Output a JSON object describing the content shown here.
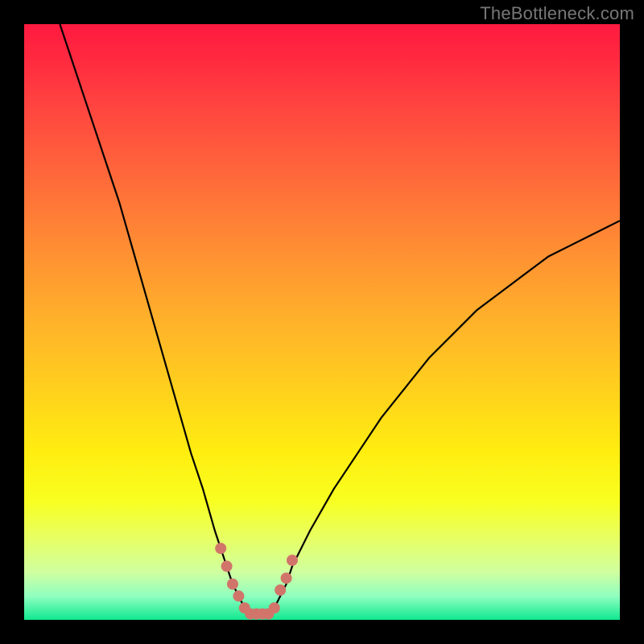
{
  "watermark": "TheBottleneck.com",
  "chart_data": {
    "type": "line",
    "title": "",
    "xlabel": "",
    "ylabel": "",
    "xlim": [
      0,
      100
    ],
    "ylim": [
      0,
      100
    ],
    "series": [
      {
        "name": "bottleneck-curve",
        "x": [
          6,
          8,
          10,
          12,
          14,
          16,
          18,
          20,
          22,
          24,
          26,
          28,
          30,
          32,
          33,
          34,
          35,
          36,
          37,
          38,
          39,
          40,
          41,
          42,
          43,
          44,
          45,
          48,
          52,
          56,
          60,
          64,
          68,
          72,
          76,
          80,
          84,
          88,
          92,
          96,
          100
        ],
        "values": [
          100,
          94,
          88,
          82,
          76,
          70,
          63,
          56,
          49,
          42,
          35,
          28,
          22,
          15,
          12,
          9,
          6,
          4,
          2,
          1,
          1,
          1,
          1,
          2,
          4,
          6,
          9,
          15,
          22,
          28,
          34,
          39,
          44,
          48,
          52,
          55,
          58,
          61,
          63,
          65,
          67
        ]
      }
    ],
    "markers": {
      "name": "highlight-dots",
      "color": "#d1756b",
      "x": [
        33,
        34,
        35,
        36,
        37,
        38,
        39,
        40,
        41,
        42,
        43,
        44,
        45
      ],
      "values": [
        12,
        9,
        6,
        4,
        2,
        1,
        1,
        1,
        1,
        2,
        5,
        7,
        10
      ]
    },
    "background_gradient": {
      "top": "#ff1a40",
      "mid": "#ffee10",
      "bottom": "#10e890"
    }
  }
}
